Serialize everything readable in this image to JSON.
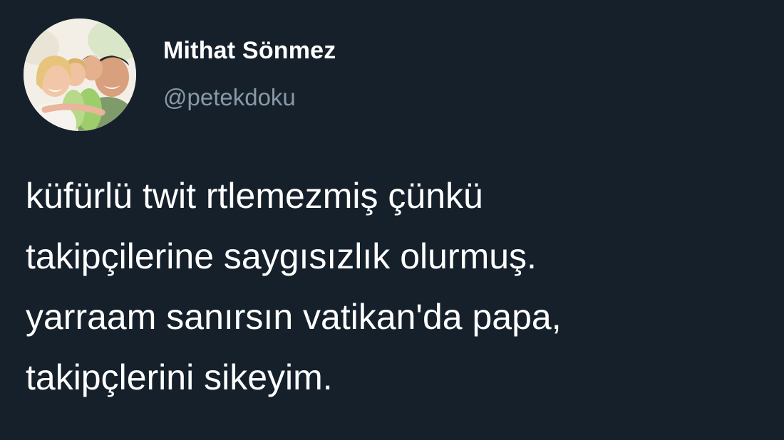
{
  "author": {
    "display_name": "Mithat Sönmez",
    "handle": "@petekdoku",
    "avatar_icon": "family-photo-avatar"
  },
  "tweet": {
    "lines": [
      "küfürlü twit rtlemezmiş çünkü",
      "takipçilerine saygısızlık olurmuş.",
      "yarraam sanırsın vatikan'da papa,",
      "takipçlerini sikeyim."
    ]
  },
  "colors": {
    "background": "#15202b",
    "text": "#ffffff",
    "secondary_text": "#8899a6"
  }
}
